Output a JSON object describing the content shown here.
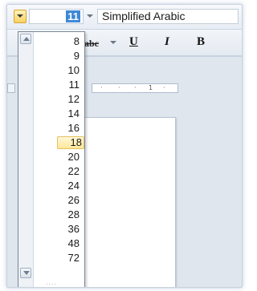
{
  "font_size": {
    "current_value": "11",
    "options": [
      "8",
      "9",
      "10",
      "11",
      "12",
      "14",
      "16",
      "18",
      "20",
      "22",
      "24",
      "26",
      "28",
      "36",
      "48",
      "72"
    ],
    "highlighted": "18"
  },
  "font_name": {
    "current_value": "Simplified Arabic"
  },
  "formatting": {
    "strikethrough_label": "abc",
    "underline_label": "U",
    "italic_label": "I",
    "bold_label": "B"
  },
  "ruler": {
    "marks": [
      "·",
      "·",
      "·",
      "1",
      "·"
    ]
  },
  "icons": {
    "dropdown_arrow": "chevron-down-icon",
    "scroll_up": "triangle-up-icon",
    "scroll_down": "triangle-down-icon",
    "resize_grip": "resize-grip-icon"
  },
  "colors": {
    "selection_bg": "#3d88d6",
    "highlight_bg": "#fde89a",
    "button_active": "#f8d264"
  }
}
